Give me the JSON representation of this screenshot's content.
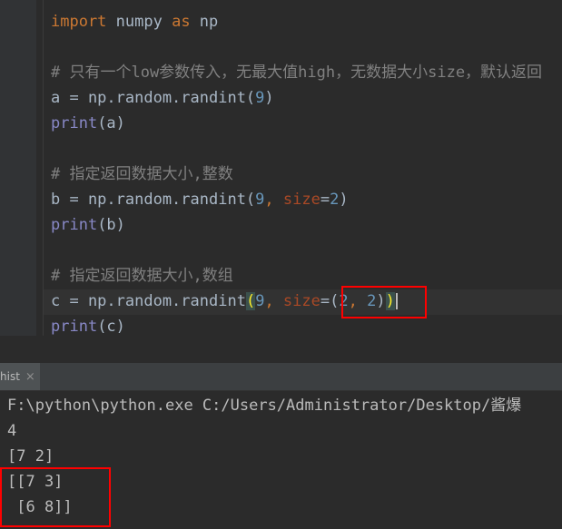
{
  "editor": {
    "lines": [
      {
        "tokens": [
          {
            "t": "kw",
            "v": "import"
          },
          {
            "t": "id",
            "v": " numpy "
          },
          {
            "t": "kw",
            "v": "as"
          },
          {
            "t": "id",
            "v": " np"
          }
        ]
      },
      {
        "tokens": []
      },
      {
        "tokens": [
          {
            "t": "cmt",
            "v": "# 只有一个low参数传入，无最大值high，无数据大小size，默认返回"
          }
        ]
      },
      {
        "tokens": [
          {
            "t": "id",
            "v": "a = np.random.randint("
          },
          {
            "t": "num",
            "v": "9"
          },
          {
            "t": "id",
            "v": ")"
          }
        ]
      },
      {
        "tokens": [
          {
            "t": "builtin",
            "v": "print"
          },
          {
            "t": "id",
            "v": "(a)"
          }
        ]
      },
      {
        "tokens": []
      },
      {
        "tokens": [
          {
            "t": "cmt",
            "v": "# 指定返回数据大小,整数"
          }
        ]
      },
      {
        "tokens": [
          {
            "t": "id",
            "v": "b = np.random.randint("
          },
          {
            "t": "num",
            "v": "9"
          },
          {
            "t": "kw",
            "v": ", "
          },
          {
            "t": "param",
            "v": "size"
          },
          {
            "t": "id",
            "v": "="
          },
          {
            "t": "num",
            "v": "2"
          },
          {
            "t": "id",
            "v": ")"
          }
        ]
      },
      {
        "tokens": [
          {
            "t": "builtin",
            "v": "print"
          },
          {
            "t": "id",
            "v": "(b)"
          }
        ]
      },
      {
        "tokens": []
      },
      {
        "tokens": [
          {
            "t": "cmt",
            "v": "# 指定返回数据大小,数组"
          }
        ]
      },
      {
        "tokens": [
          {
            "t": "id",
            "v": "c = np.random.randint"
          },
          {
            "t": "brace-match",
            "v": "("
          },
          {
            "t": "num",
            "v": "9"
          },
          {
            "t": "kw",
            "v": ", "
          },
          {
            "t": "param",
            "v": "size"
          },
          {
            "t": "id",
            "v": "=("
          },
          {
            "t": "num",
            "v": "2"
          },
          {
            "t": "kw",
            "v": ", "
          },
          {
            "t": "num",
            "v": "2"
          },
          {
            "t": "id",
            "v": ")"
          },
          {
            "t": "brace-match",
            "v": ")"
          },
          {
            "t": "caret",
            "v": ""
          }
        ]
      },
      {
        "tokens": [
          {
            "t": "builtin",
            "v": "print"
          },
          {
            "t": "id",
            "v": "(c)"
          }
        ]
      }
    ]
  },
  "run_tab": {
    "label": "hist",
    "close_glyph": "×"
  },
  "console": {
    "lines": [
      "F:\\python\\python.exe C:/Users/Administrator/Desktop/酱爆",
      "4",
      "[7 2]",
      "[[7 3]",
      " [6 8]]"
    ]
  },
  "colors": {
    "highlight_box": "#ff0000",
    "keyword": "#cc7832",
    "number": "#6897bb",
    "comment": "#808080",
    "builtin": "#8888c6"
  }
}
